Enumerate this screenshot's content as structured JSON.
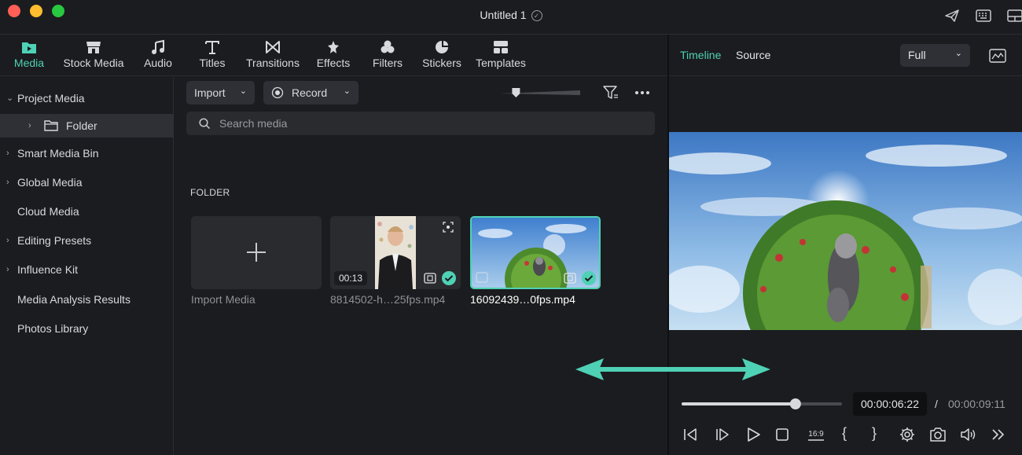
{
  "window": {
    "title": "Untitled 1"
  },
  "top_tabs": [
    {
      "label": "Media",
      "icon": "media-folder-icon",
      "active": true
    },
    {
      "label": "Stock Media",
      "icon": "store-icon"
    },
    {
      "label": "Audio",
      "icon": "music-note-icon"
    },
    {
      "label": "Titles",
      "icon": "text-t-icon"
    },
    {
      "label": "Transitions",
      "icon": "transition-bowtie-icon"
    },
    {
      "label": "Effects",
      "icon": "effects-star-icon"
    },
    {
      "label": "Filters",
      "icon": "filters-circles-icon"
    },
    {
      "label": "Stickers",
      "icon": "sticker-pie-icon"
    },
    {
      "label": "Templates",
      "icon": "templates-grid-icon"
    }
  ],
  "sidebar": {
    "items": [
      {
        "label": "Project Media",
        "chevron": "down"
      },
      {
        "label": "Folder",
        "chevron": "right",
        "selected": true
      },
      {
        "label": "Smart Media Bin",
        "chevron": "right"
      },
      {
        "label": "Global Media",
        "chevron": "right"
      },
      {
        "label": "Cloud Media",
        "chevron": ""
      },
      {
        "label": "Editing Presets",
        "chevron": "right"
      },
      {
        "label": "Influence Kit",
        "chevron": "right"
      },
      {
        "label": "Media Analysis Results",
        "chevron": ""
      },
      {
        "label": "Photos Library",
        "chevron": ""
      }
    ]
  },
  "media": {
    "import_label": "Import",
    "record_label": "Record",
    "search_placeholder": "Search media",
    "section_label": "FOLDER",
    "zoom_level": 0.2,
    "cards": [
      {
        "name": "Import Media"
      },
      {
        "name": "8814502-h…25fps.mp4",
        "duration": "00:13"
      },
      {
        "name": "16092439…0fps.mp4",
        "selected": true
      }
    ]
  },
  "preview": {
    "tabs": [
      {
        "label": "Timeline",
        "active": true
      },
      {
        "label": "Source"
      }
    ],
    "quality": "Full",
    "current_time": "00:00:06:22",
    "separator": "/",
    "total_time": "00:00:09:11",
    "progress": 0.71,
    "ratio_label": "16:9"
  },
  "colors": {
    "accent": "#4fd1b5",
    "arrow": "#4fd1b5",
    "background": "#1b1c1f",
    "panel": "#2f3035"
  }
}
